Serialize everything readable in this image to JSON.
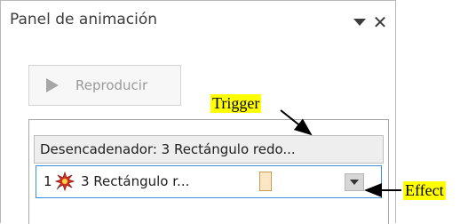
{
  "panel": {
    "title": "Panel de animación",
    "menu_icon": "chevron-down-icon",
    "close_icon": "close-icon",
    "close_glyph": "✕"
  },
  "play_button": {
    "label": "Reproducir",
    "icon": "play-icon",
    "enabled": false
  },
  "animation_list": {
    "trigger_label": "Desencadenador: 3 Rectángulo redo...",
    "effects": [
      {
        "number": "1",
        "icon": "starburst-effect-icon",
        "name": "3 Rectángulo r...",
        "selected": true,
        "timing_color": "#fbe7c4"
      }
    ]
  },
  "annotations": {
    "trigger_label": "Trigger",
    "effect_label": "Effect",
    "highlight_color": "#ffff00"
  },
  "colors": {
    "selection_border": "#3d8ee0",
    "header_background": "#eeeeee"
  }
}
